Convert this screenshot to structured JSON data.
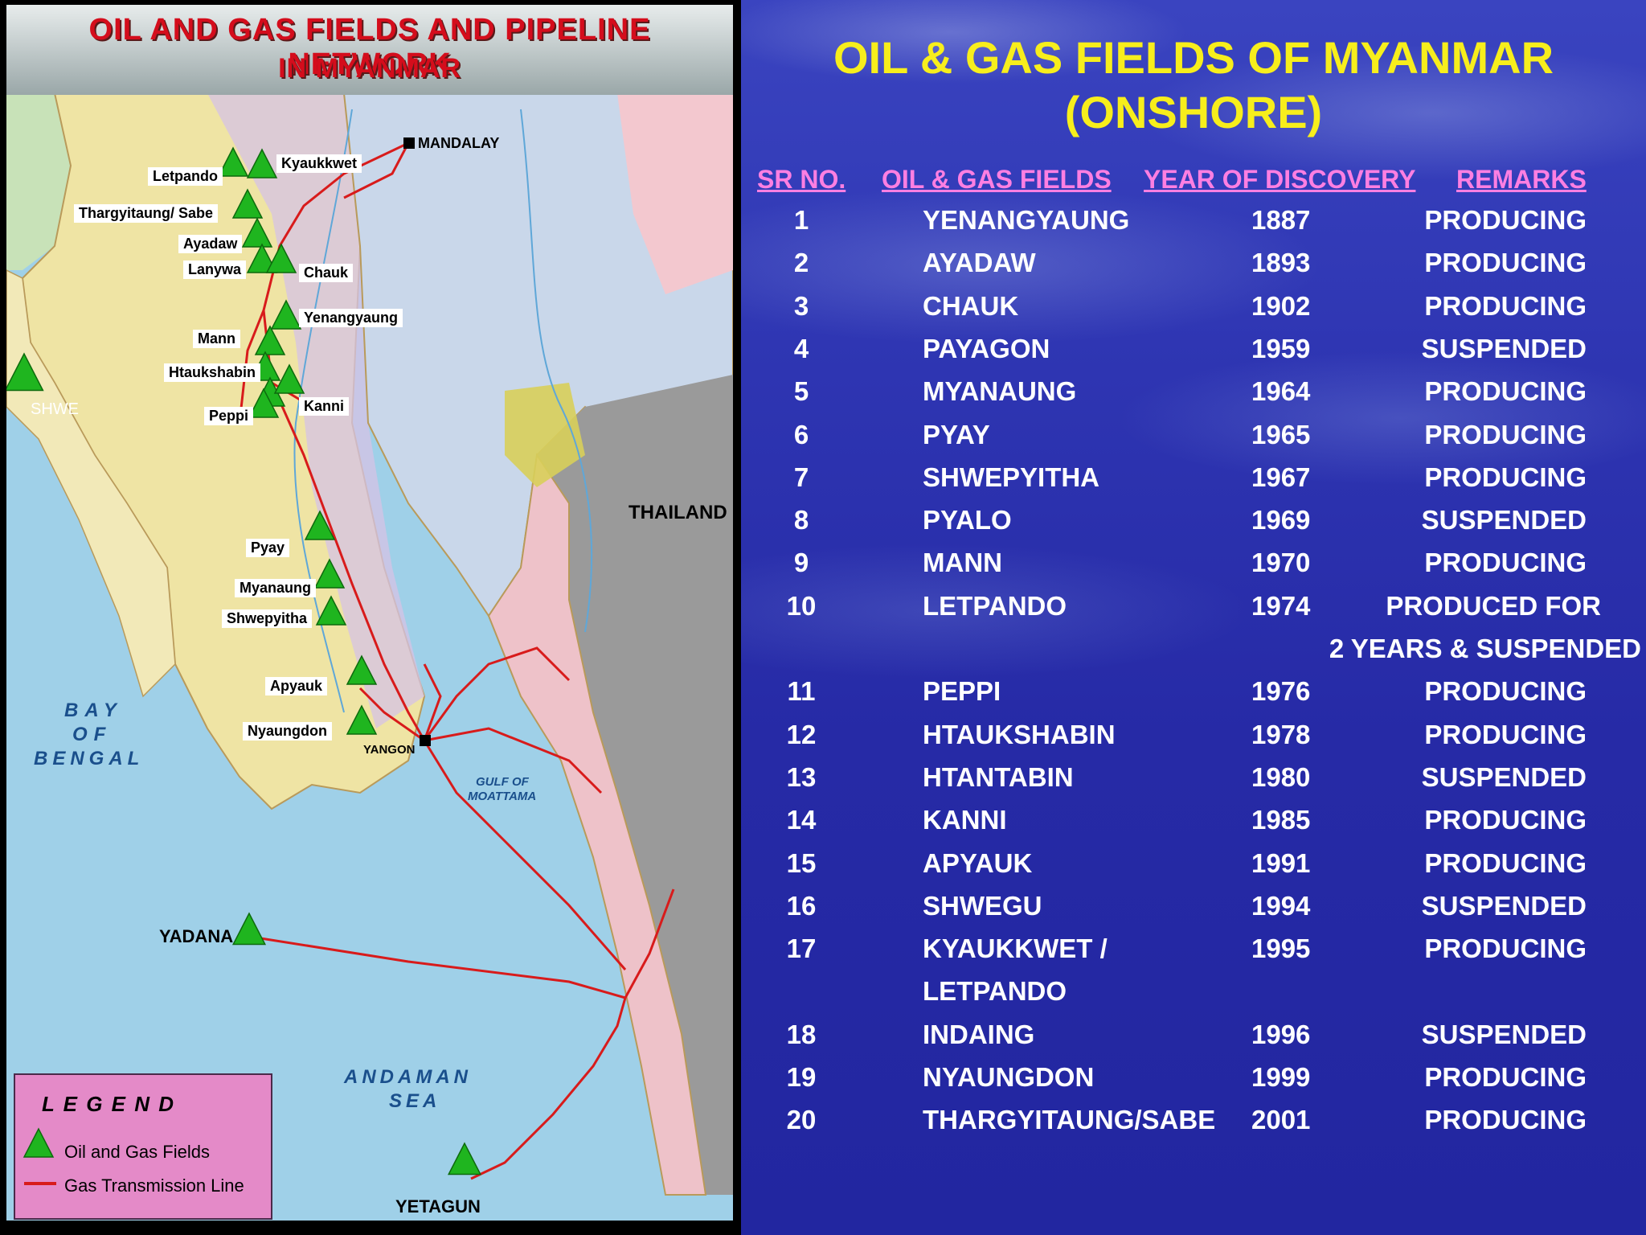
{
  "map": {
    "title_line1": "OIL AND GAS FIELDS AND PIPELINE NETWORK",
    "title_line2": "IN MYANMAR",
    "cities": {
      "mandalay": "MANDALAY",
      "yangon": "YANGON"
    },
    "regions": {
      "thailand": "THAILAND",
      "bay1": "BAY",
      "bay2": "OF",
      "bay3": "BENGAL",
      "andaman1": "ANDAMAN",
      "andaman2": "SEA",
      "gulf1": "GULF OF",
      "gulf2": "MOATTAMA"
    },
    "field_labels": [
      "Letpando",
      "Kyaukkwet",
      "Thargyitaung/ Sabe",
      "Ayadaw",
      "Lanywa",
      "Chauk",
      "Yenangyaung",
      "Mann",
      "Htaukshabin",
      "Kanni",
      "Peppi",
      "Pyay",
      "Myanaung",
      "Shwepyitha",
      "Apyauk",
      "Nyaungdon"
    ],
    "offshore_labels": {
      "shwe": "SHWE",
      "yadana": "YADANA",
      "yetagun": "YETAGUN"
    },
    "legend": {
      "title": "L E G E N D",
      "fields": "Oil and Gas Fields",
      "pipeline": "Gas Transmission Line"
    },
    "colors": {
      "field_marker": "#1fb51f",
      "pipeline": "#d81b1b",
      "sea": "#9fd0e8",
      "land_west": "#efe4a4",
      "land_east": "#c9d7ea",
      "legend_bg": "#e48ac8"
    }
  },
  "slide": {
    "title_line1": "OIL & GAS FIELDS OF MYANMAR",
    "title_line2": "(ONSHORE)",
    "headers": {
      "sr": "SR NO.",
      "field": "OIL & GAS FIELDS",
      "year": "YEAR OF DISCOVERY",
      "remarks": "REMARKS"
    },
    "rows": [
      {
        "sr": "1",
        "field": "YENANGYAUNG",
        "year": "1887",
        "remark": "PRODUCING"
      },
      {
        "sr": "2",
        "field": "AYADAW",
        "year": "1893",
        "remark": "PRODUCING"
      },
      {
        "sr": "3",
        "field": "CHAUK",
        "year": "1902",
        "remark": "PRODUCING"
      },
      {
        "sr": "4",
        "field": "PAYAGON",
        "year": "1959",
        "remark": "SUSPENDED"
      },
      {
        "sr": "5",
        "field": "MYANAUNG",
        "year": "1964",
        "remark": "PRODUCING"
      },
      {
        "sr": "6",
        "field": "PYAY",
        "year": "1965",
        "remark": "PRODUCING"
      },
      {
        "sr": "7",
        "field": "SHWEPYITHA",
        "year": "1967",
        "remark": "PRODUCING"
      },
      {
        "sr": "8",
        "field": "PYALO",
        "year": "1969",
        "remark": "SUSPENDED"
      },
      {
        "sr": "9",
        "field": "MANN",
        "year": "1970",
        "remark": "PRODUCING"
      },
      {
        "sr": "10",
        "field": "LETPANDO",
        "year": "1974",
        "remark": "PRODUCED FOR",
        "remark2": "2 YEARS & SUSPENDED"
      },
      {
        "sr": "11",
        "field": "PEPPI",
        "year": "1976",
        "remark": "PRODUCING"
      },
      {
        "sr": "12",
        "field": "HTAUKSHABIN",
        "year": "1978",
        "remark": "PRODUCING"
      },
      {
        "sr": "13",
        "field": "HTANTABIN",
        "year": "1980",
        "remark": "SUSPENDED"
      },
      {
        "sr": "14",
        "field": "KANNI",
        "year": "1985",
        "remark": "PRODUCING"
      },
      {
        "sr": "15",
        "field": "APYAUK",
        "year": "1991",
        "remark": "PRODUCING"
      },
      {
        "sr": "16",
        "field": "SHWEGU",
        "year": "1994",
        "remark": "SUSPENDED"
      },
      {
        "sr": "17",
        "field": "KYAUKKWET /",
        "field2": "LETPANDO",
        "year": "1995",
        "remark": "PRODUCING"
      },
      {
        "sr": "18",
        "field": "INDAING",
        "year": "1996",
        "remark": "SUSPENDED"
      },
      {
        "sr": "19",
        "field": "NYAUNGDON",
        "year": "1999",
        "remark": "PRODUCING"
      },
      {
        "sr": "20",
        "field": "THARGYITAUNG/SABE",
        "year": "2001",
        "remark": "PRODUCING"
      }
    ]
  }
}
